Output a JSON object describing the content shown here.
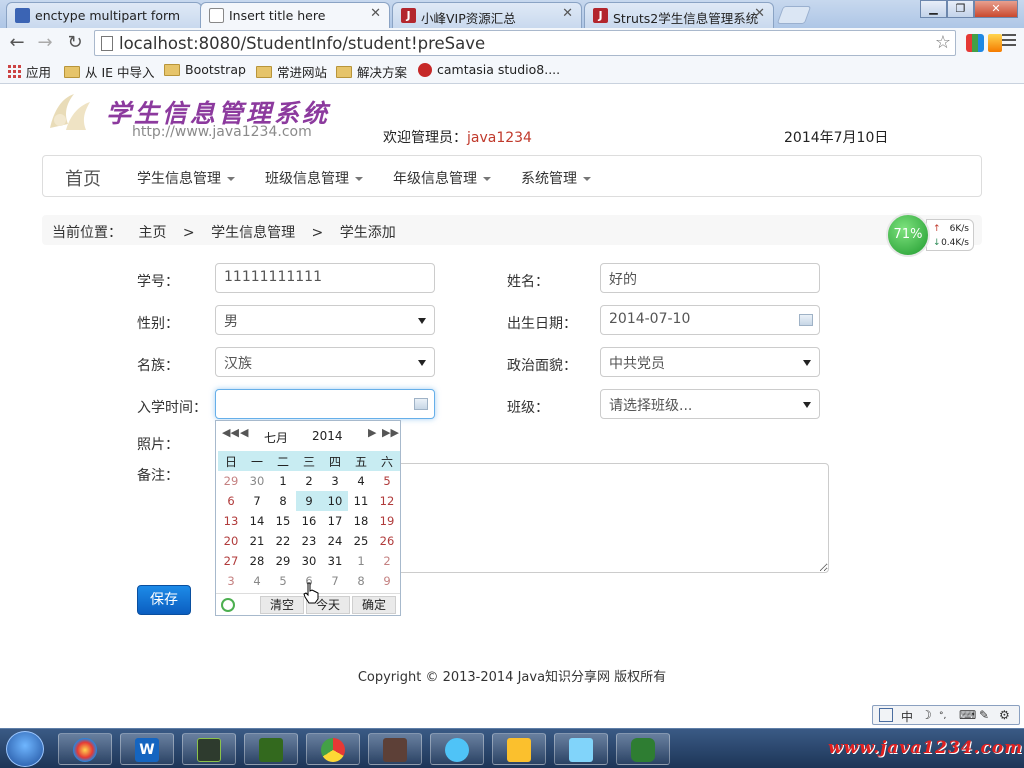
{
  "browser": {
    "tabs": [
      {
        "title": "enctype multipart form"
      },
      {
        "title": "Insert title here",
        "active": true
      },
      {
        "title": "小峰VIP资源汇总"
      },
      {
        "title": "Struts2学生信息管理系统"
      }
    ],
    "url": "localhost:8080/StudentInfo/student!preSave",
    "bookmarks": [
      "应用",
      "从 IE 中导入",
      "Bootstrap",
      "常进网站",
      "解决方案",
      "camtasia studio8...."
    ]
  },
  "header": {
    "title": "学生信息管理系统",
    "url": "http://www.java1234.com",
    "welcome_prefix": "欢迎管理员：",
    "admin": "java1234",
    "date": "2014年7月10日"
  },
  "navbar": {
    "brand": "首页",
    "items": [
      "学生信息管理",
      "班级信息管理",
      "年级信息管理",
      "系统管理"
    ]
  },
  "breadcrumb": {
    "prefix": "当前位置：",
    "items": [
      "主页",
      ">",
      "学生信息管理",
      ">",
      "学生添加"
    ]
  },
  "form": {
    "student_no_label": "学号：",
    "student_no": "11111111111",
    "name_label": "姓名：",
    "name": "好的",
    "gender_label": "性别：",
    "gender": "男",
    "birth_label": "出生日期：",
    "birth": "2014-07-10",
    "nation_label": "名族：",
    "nation": "汉族",
    "politics_label": "政治面貌：",
    "politics": "中共党员",
    "enroll_label": "入学时间：",
    "enroll": "",
    "class_label": "班级：",
    "class": "请选择班级...",
    "photo_label": "照片：",
    "notes_label": "备注：",
    "save": "保存"
  },
  "datepicker": {
    "nav_prev_year": "◀◀",
    "nav_prev_month": "◀",
    "nav_next_month": "▶",
    "nav_next_year": "▶▶",
    "month": "七月",
    "year": "2014",
    "weekdays": [
      "日",
      "一",
      "二",
      "三",
      "四",
      "五",
      "六"
    ],
    "weeks": [
      [
        "29",
        "30",
        "1",
        "2",
        "3",
        "4",
        "5"
      ],
      [
        "6",
        "7",
        "8",
        "9",
        "10",
        "11",
        "12"
      ],
      [
        "13",
        "14",
        "15",
        "16",
        "17",
        "18",
        "19"
      ],
      [
        "20",
        "21",
        "22",
        "23",
        "24",
        "25",
        "26"
      ],
      [
        "27",
        "28",
        "29",
        "30",
        "31",
        "1",
        "2"
      ],
      [
        "3",
        "4",
        "5",
        "6",
        "7",
        "8",
        "9"
      ]
    ],
    "clear": "清空",
    "today": "今天",
    "ok": "确定"
  },
  "netmon": {
    "percent": "71%",
    "up": "6K/s",
    "down": "0.4K/s"
  },
  "footer": "Copyright © 2013-2014 Java知识分享网 版权所有",
  "watermark": "www.java1234.com",
  "ime": "中"
}
